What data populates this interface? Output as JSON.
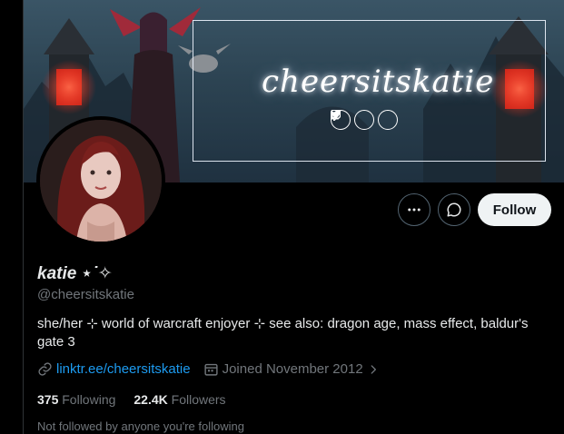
{
  "banner": {
    "brand_text": "cheersitskatie",
    "social_icons": [
      "twitter-bird-icon",
      "tiktok-icon",
      "twitch-icon"
    ]
  },
  "profile": {
    "display_name": "katie ⋆˙✧",
    "handle": "@cheersitskatie",
    "bio": "she/her ⊹ world of warcraft enjoyer ⊹ see also: dragon age, mass effect, baldur's gate 3",
    "link": "linktr.ee/cheersitskatie",
    "joined": "Joined November 2012"
  },
  "actions": {
    "more_icon": "more-dots-icon",
    "message_icon": "message-bubble-icon",
    "follow_label": "Follow"
  },
  "stats": {
    "following_count": "375",
    "following_label": "Following",
    "followers_count": "22.4K",
    "followers_label": "Followers"
  },
  "followed_by_text": "Not followed by anyone you're following",
  "colors": {
    "link": "#1d9bf0",
    "secondary_text": "#71767b",
    "primary_text": "#e7e9ea",
    "follow_button_bg": "#eff3f4",
    "background": "#000000"
  }
}
